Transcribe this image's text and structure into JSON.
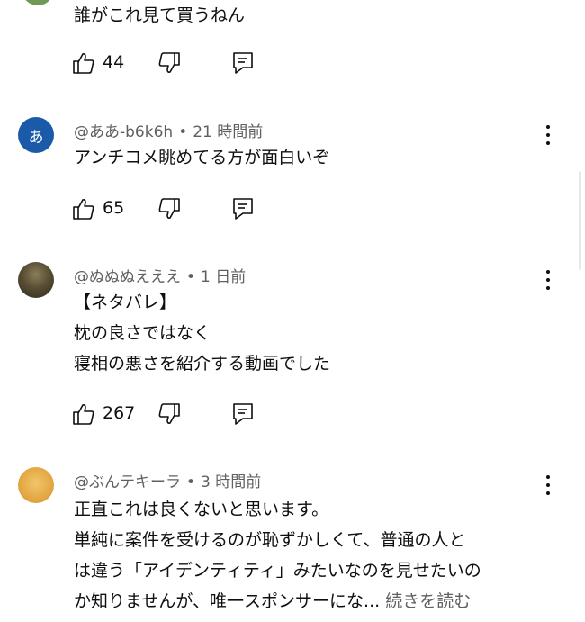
{
  "comments": [
    {
      "text_lines": [
        "誰がこれ見て買うねん"
      ],
      "likes": "44"
    },
    {
      "avatar_letter": "あ",
      "author": "@ああ-b6k6h",
      "time": "21 時間前",
      "text_lines": [
        "アンチコメ眺めてる方が面白いぞ"
      ],
      "likes": "65"
    },
    {
      "author": "@ぬぬぬえええ",
      "time": "1 日前",
      "text_lines": [
        "【ネタバレ】",
        "枕の良さではなく",
        "寝相の悪さを紹介する動画でした"
      ],
      "likes": "267"
    },
    {
      "author": "@ぶんテキーラ",
      "time": "3 時間前",
      "text_lines": [
        "正直これは良くないと思います。",
        "単純に案件を受けるのが恥ずかしくて、普通の人と",
        "は違う「アイデンティティ」みたいなのを見せたいの",
        "か知りませんが、唯一スポンサーにな..."
      ],
      "read_more": "続きを読む"
    }
  ],
  "separator": "•",
  "colors": {
    "text_primary": "#0f0f0f",
    "text_secondary": "#606060",
    "avatar_blue": "#1b5aa8"
  },
  "icons": [
    "like-icon",
    "dislike-icon",
    "reply-icon",
    "more-options-icon"
  ]
}
